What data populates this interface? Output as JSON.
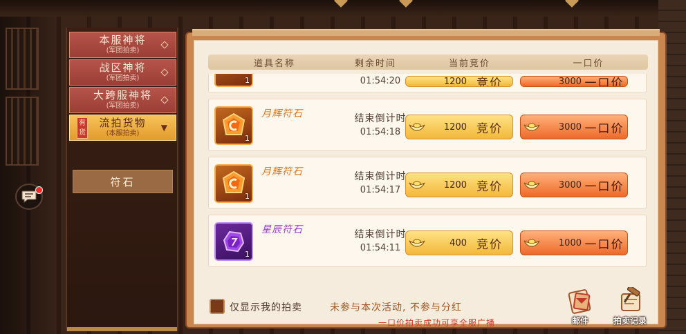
{
  "nav": {
    "items": [
      {
        "title": "本服神将",
        "sub": "(军团拍卖)"
      },
      {
        "title": "战区神将",
        "sub": "(军团拍卖)"
      },
      {
        "title": "大跨服神将",
        "sub": "(军团拍卖)"
      },
      {
        "title": "流拍货物",
        "sub": "(本服拍卖)",
        "badge": "有货"
      }
    ],
    "sub_item": "符石"
  },
  "table": {
    "headers": [
      "道具名称",
      "剩余时间",
      "当前竞价",
      "一口价"
    ]
  },
  "rows": [
    {
      "name": "",
      "countdown_label": "",
      "countdown": "01:54:20",
      "qty": "1",
      "bid_price": "1200",
      "buy_price": "3000",
      "bid_label": "竞价",
      "buy_label": "一口价",
      "rarity": "orange",
      "partial": true
    },
    {
      "name": "月辉符石",
      "countdown_label": "结束倒计时",
      "countdown": "01:54:18",
      "qty": "1",
      "bid_price": "1200",
      "buy_price": "3000",
      "bid_label": "竞价",
      "buy_label": "一口价",
      "rarity": "orange"
    },
    {
      "name": "月辉符石",
      "countdown_label": "结束倒计时",
      "countdown": "01:54:17",
      "qty": "1",
      "bid_price": "1200",
      "buy_price": "3000",
      "bid_label": "竞价",
      "buy_label": "一口价",
      "rarity": "orange"
    },
    {
      "name": "星辰符石",
      "countdown_label": "结束倒计时",
      "countdown": "01:54:11",
      "qty": "1",
      "bid_price": "400",
      "buy_price": "1000",
      "bid_label": "竞价",
      "buy_label": "一口价",
      "rarity": "purple"
    }
  ],
  "footer": {
    "checkbox_label": "仅显示我的拍卖",
    "notice": "未参与本次活动, 不参与分红",
    "broadcast": "一口价拍卖成功可享全服广播",
    "mail_label": "邮件",
    "record_label": "拍卖记录"
  },
  "colors": {
    "orange_name": "#e0761e",
    "purple_name": "#9a3ed2",
    "bid_button": "#f2b83a",
    "buy_button": "#ed6a2a"
  },
  "icons": {
    "chat": "chat-bubble-icon",
    "ingot": "gold-ingot-icon",
    "mail": "mail-scroll-icon",
    "record": "auction-record-icon"
  }
}
